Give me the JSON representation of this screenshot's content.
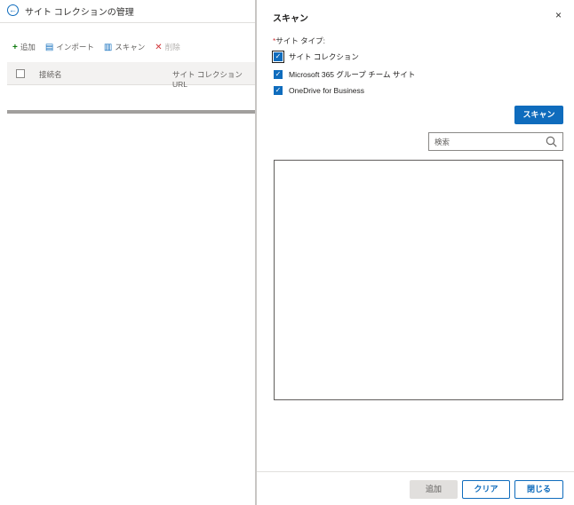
{
  "left_page": {
    "title": "サイト コレクションの管理",
    "toolbar": {
      "add_label": "追加",
      "import_label": "インポート",
      "scan_label": "スキャン",
      "delete_label": "削除"
    },
    "table": {
      "columns": [
        "接続名",
        "サイト コレクション URL"
      ]
    }
  },
  "panel": {
    "title": "スキャン",
    "close_glyph": "×",
    "site_type": {
      "required_mark": "*",
      "label": "サイト タイプ:",
      "options": [
        {
          "label": "サイト コレクション",
          "checked": true
        },
        {
          "label": "Microsoft 365 グループ チーム サイト",
          "checked": true
        },
        {
          "label": "OneDrive for Business",
          "checked": true
        }
      ]
    },
    "scan_button": "スキャン",
    "search": {
      "placeholder": "検索",
      "value": ""
    },
    "footer": {
      "add_label": "追加",
      "clear_label": "クリア",
      "close_label": "閉じる"
    }
  },
  "colors": {
    "accent": "#0f6cbd",
    "disabled_bg": "#e1dfdd",
    "border": "#8a8886"
  }
}
